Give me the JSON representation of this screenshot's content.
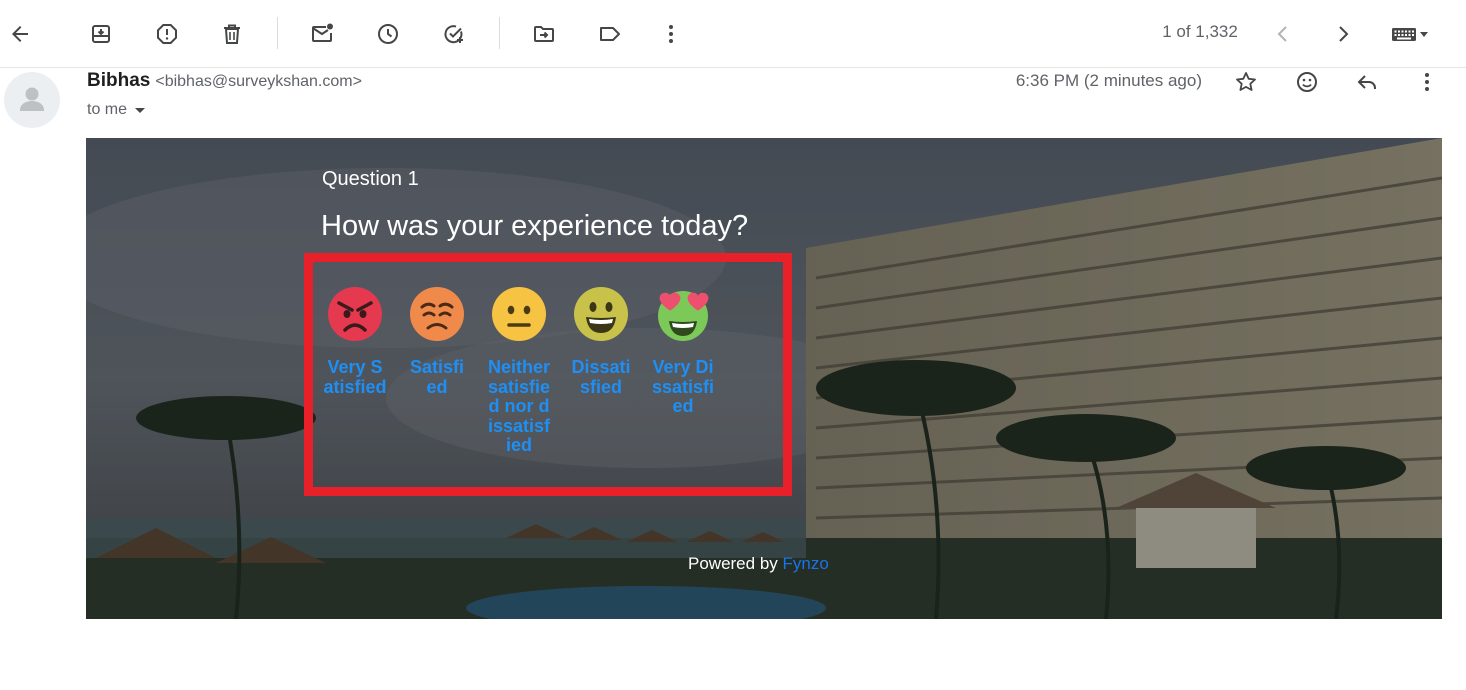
{
  "toolbar": {
    "pager_text": "1 of 1,332"
  },
  "message": {
    "sender_name": "Bibhas",
    "sender_email": "<bibhas@surveykshan.com>",
    "recipient_text": "to me",
    "timestamp": "6:36 PM (2 minutes ago)"
  },
  "survey": {
    "question_label": "Question 1",
    "question_text": "How was your experience today?",
    "options": [
      {
        "label": "Very Satisfied",
        "icon": "angry-face-icon",
        "color": "#e53950"
      },
      {
        "label": "Satisfied",
        "icon": "frowning-face-icon",
        "color": "#f08a4b"
      },
      {
        "label": "Neither satisfied nor dissatisfied",
        "icon": "neutral-face-icon",
        "color": "#f6c342"
      },
      {
        "label": "Dissatisfied",
        "icon": "grinning-face-icon",
        "color": "#c9c24a"
      },
      {
        "label": "Very Dissatisfied",
        "icon": "heart-eyes-face-icon",
        "color": "#7cc95a"
      }
    ],
    "highlight_color": "#e8202a",
    "label_color": "#1e8ff5",
    "powered_prefix": "Powered by",
    "powered_brand": "Fynzo"
  }
}
